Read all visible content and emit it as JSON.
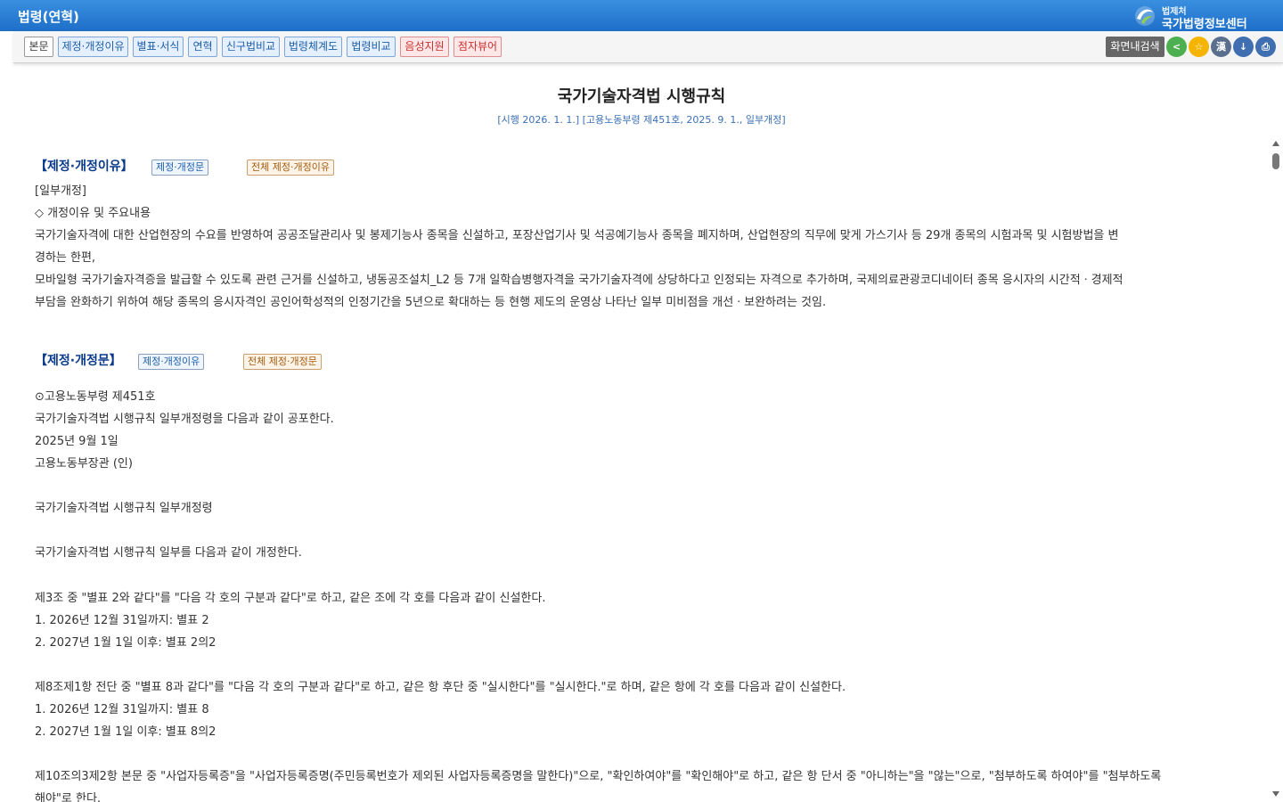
{
  "header": {
    "title": "법령(연혁)",
    "logo_small": "법제처",
    "logo_big": "국가법령정보센터"
  },
  "toolbar": {
    "tabs": [
      "본문",
      "제정·개정이유",
      "별표·서식",
      "연혁",
      "신구법비교",
      "법령체계도",
      "법령비교",
      "음성지원",
      "점자뷰어"
    ],
    "search_label": "화면내검색",
    "icons": {
      "share": "<",
      "favorite": "☆",
      "hanja": "漢",
      "download": "↓",
      "print": "⎙"
    }
  },
  "doc": {
    "title": "국가기술자격법 시행규칙",
    "subtitle": "[시행 2026. 1. 1.] [고용노동부령 제451호, 2025. 9. 1., 일부개정]",
    "reason": {
      "heading": "【제정·개정이유】",
      "btn1": "제정·개정문",
      "btn2": "전체 제정·개정이유",
      "lines": [
        "[일부개정]",
        "◇ 개정이유 및 주요내용",
        "   국가기술자격에 대한 산업현장의 수요를 반영하여 공공조달관리사 및 봉제기능사 종목을 신설하고, 포장산업기사 및 석공예기능사 종목을 폐지하며, 산업현장의 직무에 맞게 가스기사 등 29개 종목의 시험과목 및 시험방법을 변",
        "경하는 한편,",
        "   모바일형 국가기술자격증을 발급할 수 있도록 관련 근거를 신설하고, 냉동공조설치_L2 등 7개 일학습병행자격을 국가기술자격에 상당하다고 인정되는 자격으로 추가하며, 국제의료관광코디네이터 종목 응시자의 시간적ㆍ경제적",
        "부담을 완화하기 위하여 해당 종목의 응시자격인 공인어학성적의 인정기간을 5년으로 확대하는 등 현행 제도의 운영상 나타난 일부 미비점을 개선ㆍ보완하려는 것임."
      ]
    },
    "text": {
      "heading": "【제정·개정문】",
      "btn1": "제정·개정이유",
      "btn2": "전체 제정·개정문",
      "lines": [
        "⊙고용노동부령 제451호",
        "   국가기술자격법 시행규칙 일부개정령을 다음과 같이 공포한다.",
        "      2025년 9월 1일",
        "            고용노동부장관 (인)",
        "",
        "국가기술자격법 시행규칙 일부개정령",
        "",
        "국가기술자격법 시행규칙 일부를 다음과 같이 개정한다.",
        "",
        "제3조 중 \"별표 2와 같다\"를 \"다음 각 호의 구분과 같다\"로 하고, 같은 조에 각 호를 다음과 같이 신설한다.",
        "   1. 2026년 12월 31일까지: 별표 2",
        "   2. 2027년 1월 1일 이후: 별표 2의2",
        "",
        "제8조제1항 전단 중 \"별표 8과 같다\"를 \"다음 각 호의 구분과 같다\"로 하고, 같은 항 후단 중 \"실시한다\"를 \"실시한다.\"로 하며, 같은 항에 각 호를 다음과 같이 신설한다.",
        "   1. 2026년 12월 31일까지: 별표 8",
        "   2. 2027년 1월 1일 이후: 별표 8의2",
        "",
        "제10조의3제2항 본문 중 \"사업자등록증\"을 \"사업자등록증명(주민등록번호가 제외된 사업자등록증명을 말한다)\"으로, \"확인하여야\"를 \"확인해야\"로 하고, 같은 항 단서 중 \"아니하는\"을 \"않는\"으로, \"첨부하도록 하여야\"를 \"첨부하도록",
        "해야\"로 한다."
      ]
    }
  }
}
